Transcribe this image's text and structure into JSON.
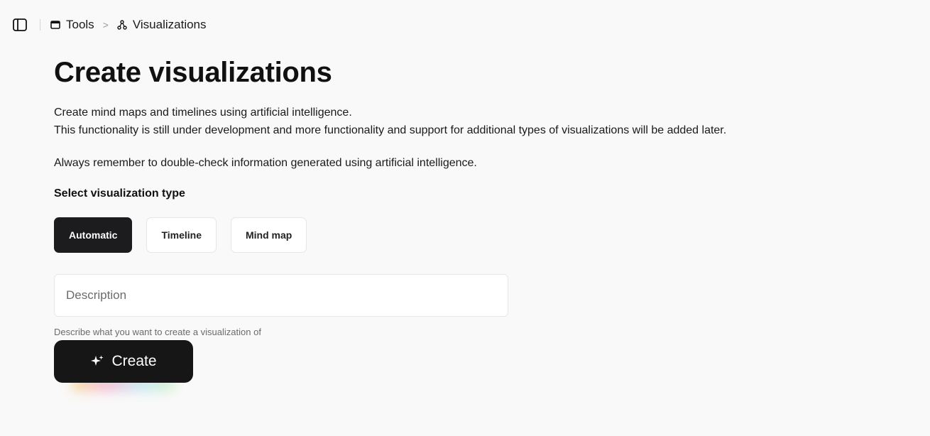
{
  "breadcrumb": {
    "items": [
      {
        "label": "Tools",
        "icon": "window-icon"
      },
      {
        "label": "Visualizations",
        "icon": "nodes-icon"
      }
    ],
    "separator": ">"
  },
  "page": {
    "title": "Create visualizations",
    "intro_line1": "Create mind maps and timelines using artificial intelligence.",
    "intro_line2": "This functionality is still under development and more functionality and support for additional types of visualizations will be added later.",
    "reminder": "Always remember to double-check information generated using artificial intelligence."
  },
  "type_selector": {
    "label": "Select visualization type",
    "options": [
      {
        "label": "Automatic",
        "selected": true
      },
      {
        "label": "Timeline",
        "selected": false
      },
      {
        "label": "Mind map",
        "selected": false
      }
    ]
  },
  "description": {
    "value": "",
    "placeholder": "Description",
    "hint": "Describe what you want to create a visualization of"
  },
  "create_button": {
    "label": "Create",
    "icon": "sparkle-icon"
  },
  "colors": {
    "background": "#f9f9f9",
    "selected_button": "#1c1c1e",
    "create_button": "#161616",
    "text": "#111111",
    "muted_text": "#6b6b6b"
  }
}
